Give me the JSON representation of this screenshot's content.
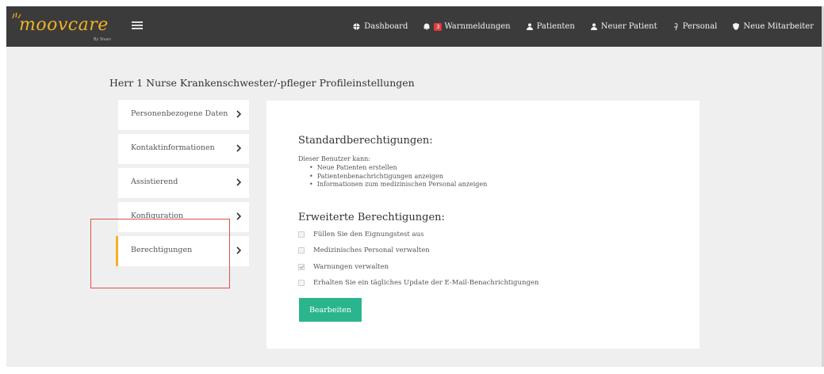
{
  "brand": {
    "logo_text": "moovcare",
    "sub_text": "By Sivan",
    "accent": "#f0b323"
  },
  "nav": [
    {
      "label": "Dashboard",
      "icon": "globe-icon"
    },
    {
      "label": "Warnmeldungen",
      "icon": "bell-icon",
      "badge": "3"
    },
    {
      "label": "Patienten",
      "icon": "user-icon"
    },
    {
      "label": "Neuer Patient",
      "icon": "user-icon"
    },
    {
      "label": "Personal",
      "icon": "staff-icon"
    },
    {
      "label": "Neue Mitarbeiter",
      "icon": "shield-icon"
    }
  ],
  "page_title": "Herr 1 Nurse Krankenschwester/-pfleger Profileinstellungen",
  "tabs": [
    {
      "label": "Personenbezogene Daten"
    },
    {
      "label": "Kontaktinformationen"
    },
    {
      "label": "Assistierend"
    },
    {
      "label": "Konfiguration"
    },
    {
      "label": "Berechtigungen",
      "active": true
    }
  ],
  "standard": {
    "title": "Standardberechtigungen:",
    "description": "Dieser Benutzer kann:",
    "items": [
      "Neue Patienten erstellen",
      "Patientenbenachrichtigungen anzeigen",
      "Informationen zum medizinischen Personal anzeigen"
    ]
  },
  "extended": {
    "title": "Erweiterte Berechtigungen:",
    "options": [
      {
        "label": "Füllen Sie den Eignungstest aus",
        "checked": false
      },
      {
        "label": "Medizinisches Personal verwalten",
        "checked": false
      },
      {
        "label": "Warnungen verwalten",
        "checked": true
      },
      {
        "label": "Erhalten Sie ein tägliches Update der E-Mail-Benachrichtigungen",
        "checked": false
      }
    ]
  },
  "edit_button": "Bearbeiten",
  "colors": {
    "topbar": "#3b3b3b",
    "button": "#2bb58e",
    "badge": "#e03b3b",
    "highlight": "#d9534f"
  }
}
